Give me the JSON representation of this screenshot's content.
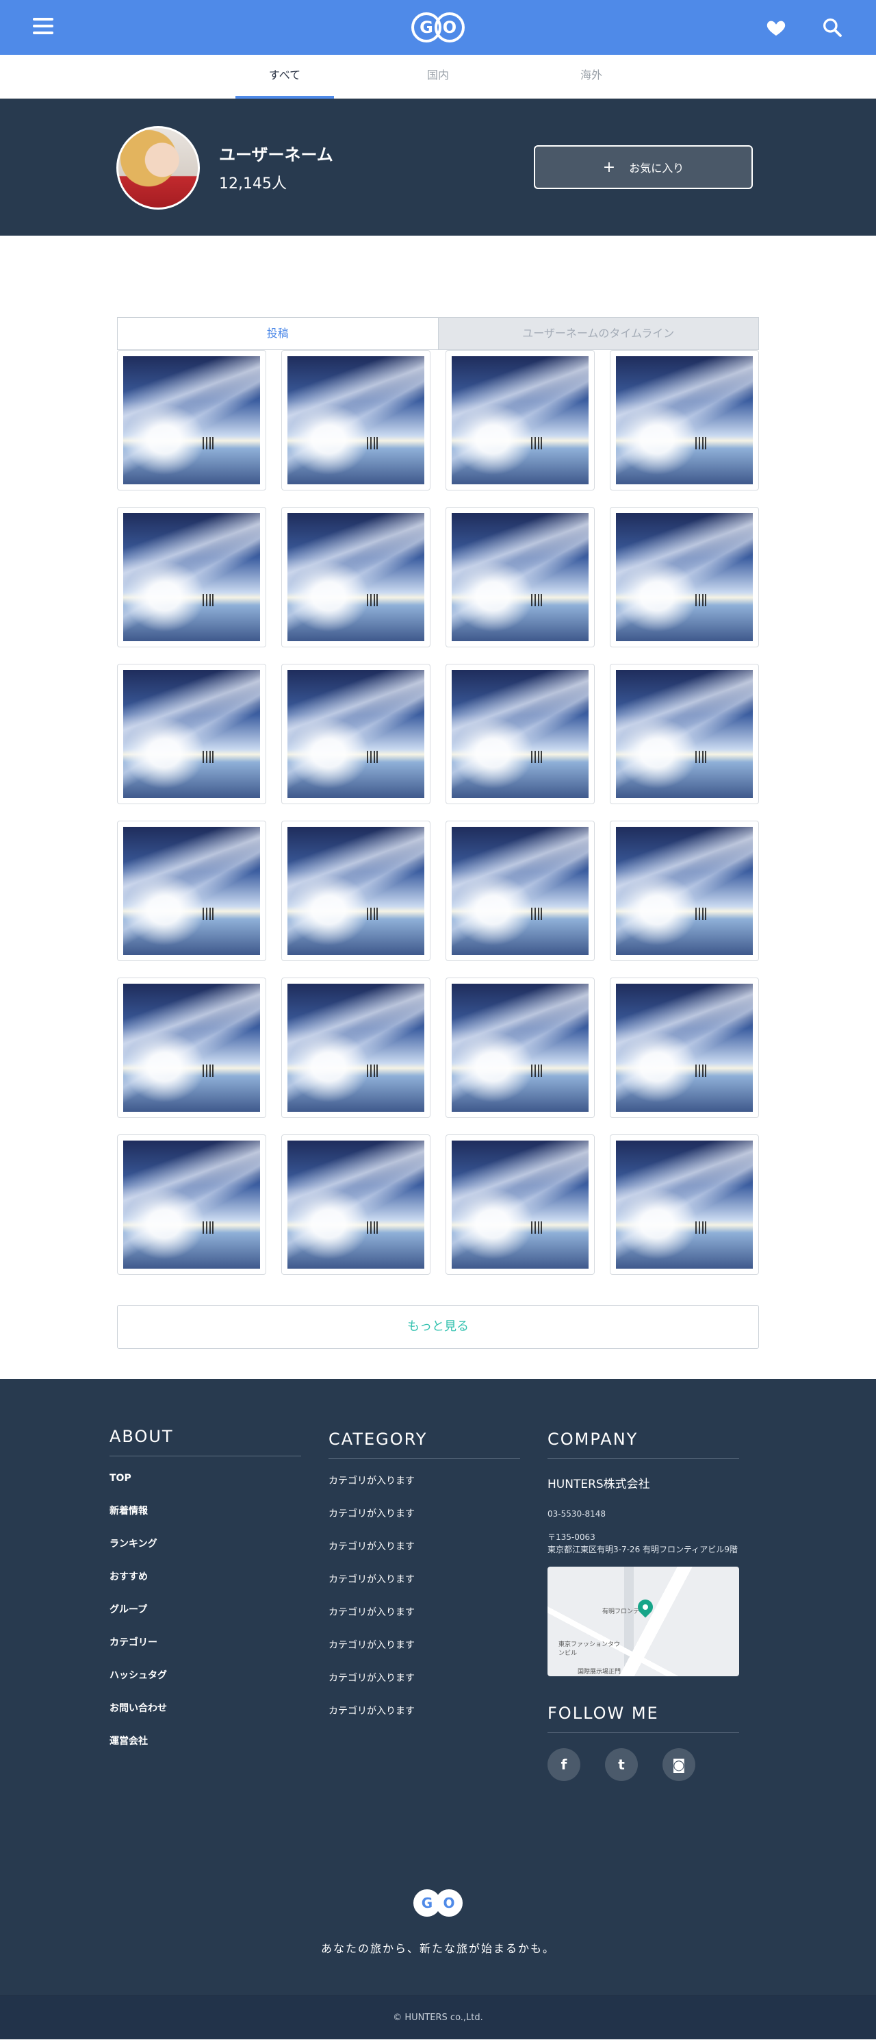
{
  "header": {
    "menu_icon": "hamburger-menu-icon",
    "logo": "GO",
    "favorites_icon": "heart-icon",
    "search_icon": "search-icon",
    "brand_color": "#4f8ae8"
  },
  "tabs": [
    {
      "label": "すべて",
      "active": true
    },
    {
      "label": "国内",
      "active": false
    },
    {
      "label": "海外",
      "active": false
    }
  ],
  "profile": {
    "user_name": "ユーザーネーム",
    "follower_count": "12,145人",
    "favorite_button": {
      "icon": "plus-icon",
      "label": "お気に入り"
    }
  },
  "content_tabs": [
    {
      "label": "投稿",
      "active": true
    },
    {
      "label": "ユーザーネームのタイムライン",
      "active": false
    }
  ],
  "grid": {
    "columns": 4,
    "rows": 6
  },
  "more_button": "もっと見る",
  "footer": {
    "about": {
      "heading": "ABOUT",
      "items": [
        "TOP",
        "新着情報",
        "ランキング",
        "おすすめ",
        "グループ",
        "カテゴリー",
        "ハッシュタグ",
        "お問い合わせ",
        "運営会社"
      ]
    },
    "category": {
      "heading": "CATEGORY",
      "items": [
        "カテゴリが入ります",
        "カテゴリが入ります",
        "カテゴリが入ります",
        "カテゴリが入ります",
        "カテゴリが入ります",
        "カテゴリが入ります",
        "カテゴリが入ります",
        "カテゴリが入ります"
      ]
    },
    "company": {
      "heading": "COMPANY",
      "name": "HUNTERS株式会社",
      "phone": "03-5530-8148",
      "address": "〒135-0063\n東京都江東区有明3-7-26 有明フロンティアビル9階",
      "map_labels": [
        "有明フロンティア",
        "東京ファッションタウンビル",
        "国際展示場正門"
      ]
    },
    "follow": {
      "heading": "FOLLOW ME",
      "socials": [
        {
          "icon": "facebook-icon",
          "glyph": "f"
        },
        {
          "icon": "twitter-icon",
          "glyph": "t"
        },
        {
          "icon": "instagram-icon",
          "glyph": "◙"
        }
      ]
    },
    "logo": "GO",
    "tagline": "あなたの旅から、新たな旅が始まるかも。",
    "copyright": "© HUNTERS co.,Ltd."
  }
}
